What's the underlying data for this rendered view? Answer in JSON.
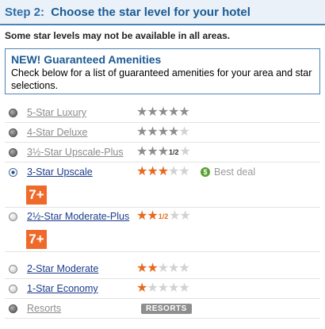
{
  "header": {
    "step": "Step 2:",
    "title": "Choose the star level for your hotel"
  },
  "subtitle": "Some star levels may not be available in all areas.",
  "guaranteed": {
    "title": "NEW! Guaranteed Amenities",
    "text": "Check below for a list of guaranteed amenities for your area and star selections."
  },
  "options": [
    {
      "label": "5-Star Luxury",
      "stars_filled": 5,
      "stars_total": 5,
      "enabled": false,
      "selected": false
    },
    {
      "label": "4-Star Deluxe",
      "stars_filled": 4,
      "stars_total": 5,
      "enabled": false,
      "selected": false
    },
    {
      "label": "3½-Star Upscale-Plus",
      "stars_filled": 3,
      "half": "1/2",
      "stars_total": 5,
      "enabled": false,
      "selected": false
    },
    {
      "label": "3-Star Upscale",
      "stars_filled": 3,
      "stars_total": 5,
      "enabled": true,
      "selected": true,
      "badge": "7+",
      "deal_icon": "$",
      "deal_text": "Best deal"
    },
    {
      "label": "2½-Star Moderate-Plus",
      "stars_filled": 2,
      "half": "1/2",
      "stars_total": 5,
      "enabled": true,
      "selected": false,
      "badge": "7+"
    },
    {
      "label": "2-Star Moderate",
      "stars_filled": 2,
      "stars_total": 5,
      "enabled": true,
      "selected": false
    },
    {
      "label": "1-Star Economy",
      "stars_filled": 1,
      "stars_total": 5,
      "enabled": true,
      "selected": false
    },
    {
      "label": "Resorts",
      "tag": "RESORTS",
      "enabled": false,
      "selected": false
    }
  ],
  "colors": {
    "header_bg": "#eaf1f8",
    "header_text": "#1b5a92",
    "link": "#1c3c8c",
    "disabled_text": "#8c8c8c",
    "star_orange": "#e56a1f",
    "star_grey": "#8d8d8d",
    "badge": "#ef6a2a",
    "deal_green": "#5a9e31"
  },
  "icons": {
    "star": "star-icon",
    "deal": "dollar-icon"
  }
}
